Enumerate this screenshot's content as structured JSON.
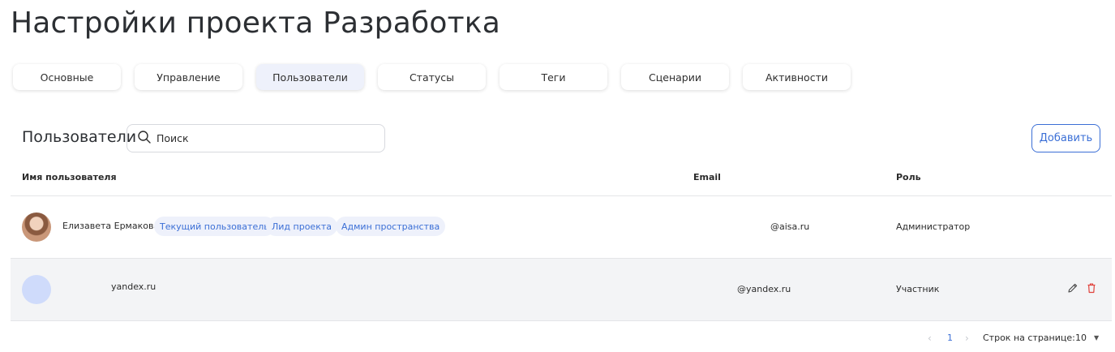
{
  "page": {
    "title": "Настройки проекта Разработка"
  },
  "tabs": [
    {
      "label": "Основные"
    },
    {
      "label": "Управление"
    },
    {
      "label": "Пользователи",
      "active": true
    },
    {
      "label": "Статусы"
    },
    {
      "label": "Теги"
    },
    {
      "label": "Сценарии"
    },
    {
      "label": "Активности"
    }
  ],
  "section": {
    "title": "Пользователи",
    "search_placeholder": "Поиск",
    "add_label": "Добавить"
  },
  "table": {
    "headers": {
      "name": "Имя пользователя",
      "email": "Email",
      "role": "Роль"
    },
    "rows": [
      {
        "name": "Елизавета Ермакова",
        "badges": [
          "Текущий пользователь",
          "Лид проекта",
          "Админ пространства"
        ],
        "email": "@aisa.ru",
        "role": "Администратор",
        "avatar": "photo"
      },
      {
        "name": "yandex.ru",
        "email": "@yandex.ru",
        "role": "Участник",
        "avatar": "placeholder"
      }
    ]
  },
  "pagination": {
    "current_page": "1",
    "prev_icon": "chevron-left-icon",
    "next_icon": "chevron-right-icon",
    "rows_label": "Строк на странице:",
    "rows_per_page": "10"
  },
  "colors": {
    "accent": "#3b6fd6",
    "badge_bg": "#eef1fb",
    "delete": "#e0413b",
    "avatar_placeholder": "#cfdbfb"
  }
}
